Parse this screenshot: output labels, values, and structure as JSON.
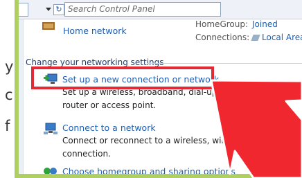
{
  "article": {
    "fragments": [
      "y",
      "c",
      "f"
    ]
  },
  "address_bar": {
    "search_placeholder": "Search Control Panel"
  },
  "network": {
    "name": "Home network",
    "homegroup_label": "HomeGroup:",
    "homegroup_value": "Joined",
    "connections_label": "Connections:",
    "connections_value": "Local Area C"
  },
  "section": {
    "heading": "Change your networking settings"
  },
  "tasks": [
    {
      "link": "Set up a new connection or network",
      "desc_line1": "Set up a wireless, broadband, dial-up, ad hoc, or VPN connection; or",
      "desc_line2": "router or access point."
    },
    {
      "link": "Connect to a network",
      "desc_line1": "Connect or reconnect to a wireless, wired, dial-up, or VPN network",
      "desc_line2": "connection."
    },
    {
      "link": "Choose homegroup and sharing options"
    }
  ],
  "colors": {
    "highlight": "#e02a35",
    "frame": "#b0cf62",
    "link": "#1e5fb4"
  }
}
